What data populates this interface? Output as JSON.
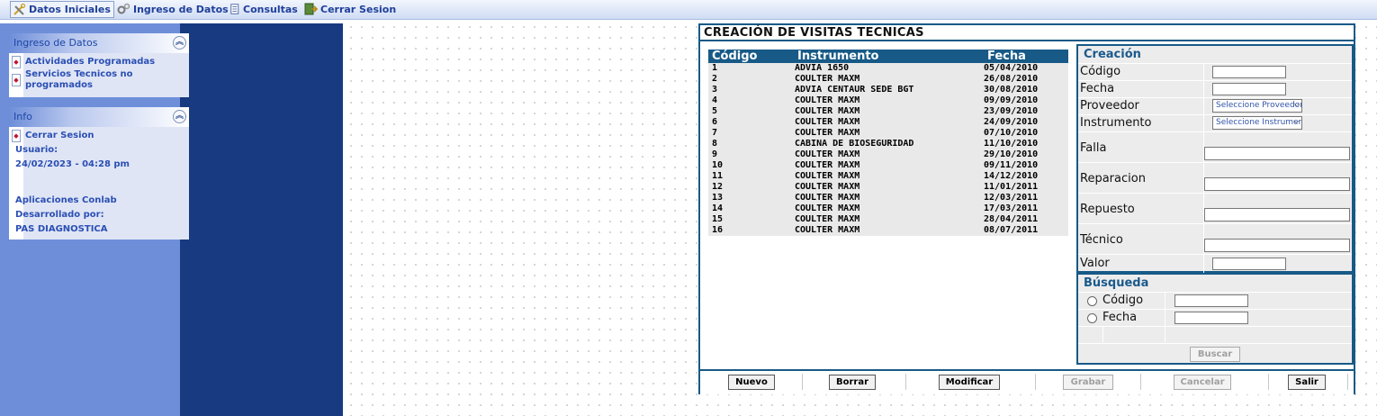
{
  "menu": {
    "items": [
      {
        "label": "Datos Iniciales",
        "icon": "tools-icon"
      },
      {
        "label": "Ingreso de Datos",
        "icon": "gears-icon"
      },
      {
        "label": "Consultas",
        "icon": "document-icon"
      },
      {
        "label": "Cerrar Sesion",
        "icon": "exit-icon"
      }
    ]
  },
  "sidebar": {
    "ingreso": {
      "title": "Ingreso de Datos",
      "items": [
        "Actividades Programadas",
        "Servicios Tecnicos no",
        "programados"
      ]
    },
    "info": {
      "title": "Info",
      "cerrar": "Cerrar Sesion",
      "usuario_label": "Usuario:",
      "datetime": "24/02/2023 - 04:28 pm",
      "app": "Aplicaciones Conlab",
      "dev_label": "Desarrollado por:",
      "dev": "PAS DIAGNOSTICA"
    }
  },
  "form": {
    "title": "CREACIÓN DE VISITAS TECNICAS",
    "table": {
      "headers": [
        "Código",
        "Instrumento",
        "Fecha"
      ],
      "rows": [
        [
          "1",
          "ADVIA 1650",
          "05/04/2010"
        ],
        [
          "2",
          "COULTER MAXM",
          "26/08/2010"
        ],
        [
          "3",
          "ADVIA CENTAUR SEDE BGT",
          "30/08/2010"
        ],
        [
          "4",
          "COULTER MAXM",
          "09/09/2010"
        ],
        [
          "5",
          "COULTER MAXM",
          "23/09/2010"
        ],
        [
          "6",
          "COULTER MAXM",
          "24/09/2010"
        ],
        [
          "7",
          "COULTER MAXM",
          "07/10/2010"
        ],
        [
          "8",
          "CABINA DE BIOSEGURIDAD",
          "11/10/2010"
        ],
        [
          "9",
          "COULTER MAXM",
          "29/10/2010"
        ],
        [
          "10",
          "COULTER MAXM",
          "09/11/2010"
        ],
        [
          "11",
          "COULTER MAXM",
          "14/12/2010"
        ],
        [
          "12",
          "COULTER MAXM",
          "11/01/2011"
        ],
        [
          "13",
          "COULTER MAXM",
          "12/03/2011"
        ],
        [
          "14",
          "COULTER MAXM",
          "17/03/2011"
        ],
        [
          "15",
          "COULTER MAXM",
          "28/04/2011"
        ],
        [
          "16",
          "COULTER MAXM",
          "08/07/2011"
        ]
      ]
    },
    "creacion": {
      "title": "Creación",
      "codigo_label": "Código",
      "fecha_label": "Fecha",
      "proveedor_label": "Proveedor",
      "proveedor_value": "Seleccione Proveedor",
      "instrumento_label": "Instrumento",
      "instrumento_value": "Seleccione Instrumento",
      "falla_label": "Falla",
      "reparacion_label": "Reparacion",
      "repuesto_label": "Repuesto",
      "tecnico_label": "Técnico",
      "valor_label": "Valor"
    },
    "busqueda": {
      "title": "Búsqueda",
      "codigo_label": "Código",
      "fecha_label": "Fecha",
      "buscar": "Buscar"
    },
    "buttons": {
      "nuevo": "Nuevo",
      "borrar": "Borrar",
      "modificar": "Modificar",
      "grabar": "Grabar",
      "cancelar": "Cancelar",
      "salir": "Salir"
    }
  },
  "colors": {
    "accent": "#175a87",
    "sidebar_light": "#6e8ed9",
    "sidebar_dark": "#173a80"
  }
}
